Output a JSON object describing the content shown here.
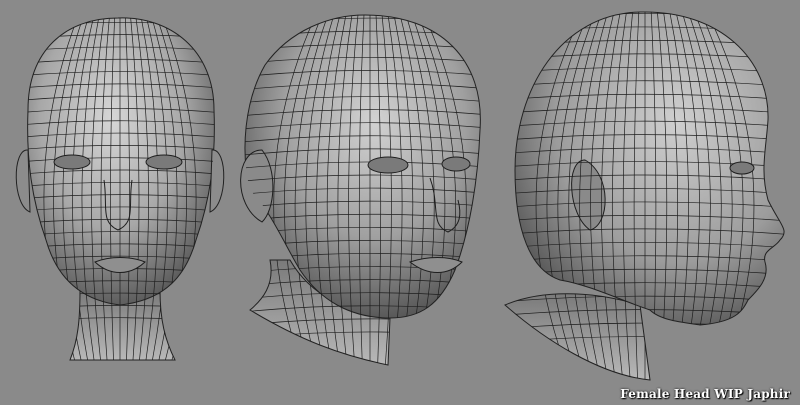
{
  "caption": {
    "text": "Female Head WIP Japhir"
  },
  "colors": {
    "background": "#8a8a8a",
    "skin_light": "#d4d4d4",
    "skin_mid": "#9c9c9c",
    "skin_dark": "#4a4a4a",
    "wire": "#1e1e1e",
    "caption_text": "#ffffff"
  },
  "views": [
    {
      "name": "front"
    },
    {
      "name": "three-quarter"
    },
    {
      "name": "side"
    }
  ]
}
